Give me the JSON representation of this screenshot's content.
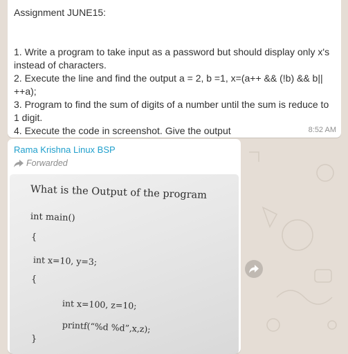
{
  "message1": {
    "lines": [
      "Assignment JUNE15:",
      "",
      "1. Write a program to take input as a password but should display only x's instead of characters.",
      "2. Execute the line and find the output a = 2, b =1, x=(a++ && (!b) && b|| ++a);",
      "3. Program to find the sum of digits of a number until the sum is reduce to 1 digit.",
      "4. Execute the code in screenshot. Give the output"
    ],
    "time": "8:52 AM"
  },
  "message2": {
    "sender": "Rama Krishna Linux BSP",
    "forwarded_label": "Forwarded",
    "photo_lines": [
      "What is the Output of the program",
      "int main()",
      "{",
      "int x=10, y=3;",
      "{",
      "int x=100, z=10;",
      "printf(“%d %d”,x,z);",
      "}"
    ]
  },
  "colors": {
    "wallpaper": "#e5ddd5",
    "sender_name": "#1f9fcc",
    "bubble": "#ffffff"
  },
  "icons": [
    "forward-arrow-icon",
    "share-icon"
  ]
}
